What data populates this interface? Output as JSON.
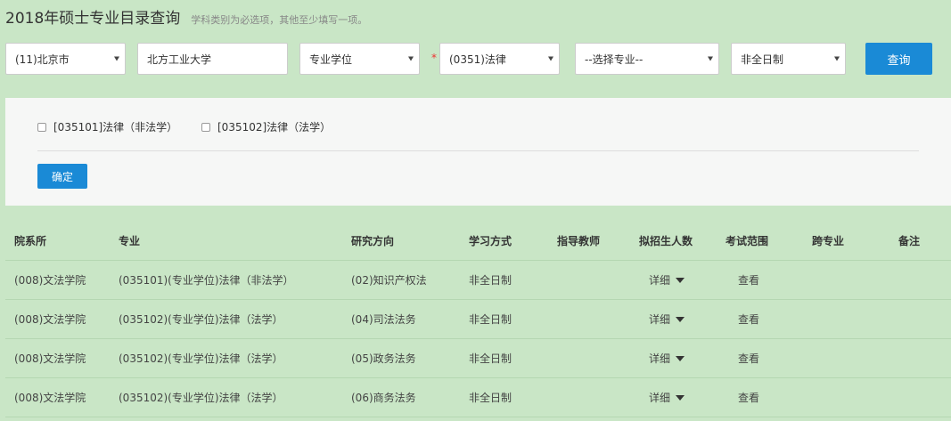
{
  "header": {
    "title": "2018年硕士专业目录查询",
    "hint": "学科类别为必选项，其他至少填写一项。"
  },
  "filters": {
    "province": "(11)北京市",
    "school": "北方工业大学",
    "degree_type": "专业学位",
    "required_mark": "*",
    "subject": "(0351)法律",
    "major": "--选择专业--",
    "study_mode": "非全日制",
    "query_label": "查询"
  },
  "panel": {
    "options": [
      {
        "label": "[035101]法律（非法学）",
        "checked": false
      },
      {
        "label": "[035102]法律（法学）",
        "checked": false
      }
    ],
    "confirm_label": "确定"
  },
  "table": {
    "headers": [
      "院系所",
      "专业",
      "研究方向",
      "学习方式",
      "指导教师",
      "拟招生人数",
      "考试范围",
      "跨专业",
      "备注"
    ],
    "rows": [
      {
        "dept": "(008)文法学院",
        "major": "(035101)(专业学位)法律（非法学）",
        "direction": "(02)知识产权法",
        "mode": "非全日制",
        "advisor": "",
        "enroll": "详细",
        "scope": "查看",
        "cross": "",
        "note": ""
      },
      {
        "dept": "(008)文法学院",
        "major": "(035102)(专业学位)法律（法学）",
        "direction": "(04)司法法务",
        "mode": "非全日制",
        "advisor": "",
        "enroll": "详细",
        "scope": "查看",
        "cross": "",
        "note": ""
      },
      {
        "dept": "(008)文法学院",
        "major": "(035102)(专业学位)法律（法学）",
        "direction": "(05)政务法务",
        "mode": "非全日制",
        "advisor": "",
        "enroll": "详细",
        "scope": "查看",
        "cross": "",
        "note": ""
      },
      {
        "dept": "(008)文法学院",
        "major": "(035102)(专业学位)法律（法学）",
        "direction": "(06)商务法务",
        "mode": "非全日制",
        "advisor": "",
        "enroll": "详细",
        "scope": "查看",
        "cross": "",
        "note": ""
      }
    ]
  },
  "colors": {
    "background": "#c9e6c6",
    "primary_button": "#1a8ad6",
    "panel": "#f6f7f6"
  }
}
